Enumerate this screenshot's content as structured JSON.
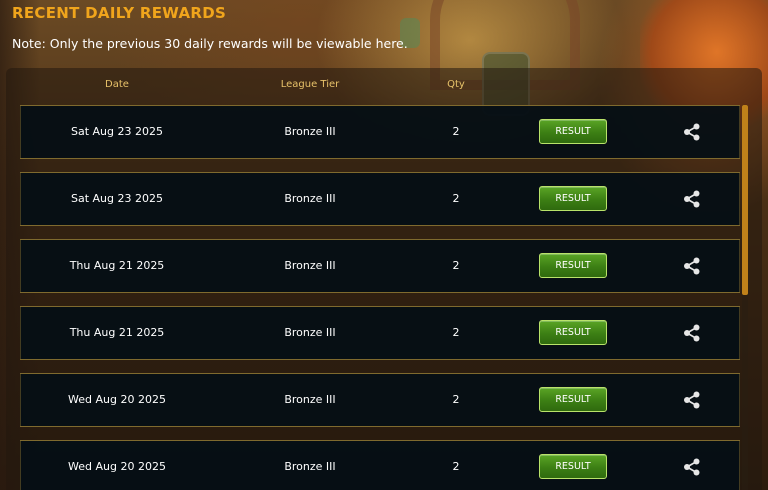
{
  "title": "RECENT DAILY REWARDS",
  "note": "Note: Only the previous 30 daily rewards will be viewable here.",
  "table": {
    "columns": {
      "date": "Date",
      "tier": "League Tier",
      "qty": "Qty"
    },
    "rows": [
      {
        "date": "Sat Aug 23 2025",
        "tier": "Bronze III",
        "qty": "2",
        "result_label": "RESULT"
      },
      {
        "date": "Sat Aug 23 2025",
        "tier": "Bronze III",
        "qty": "2",
        "result_label": "RESULT"
      },
      {
        "date": "Thu Aug 21 2025",
        "tier": "Bronze III",
        "qty": "2",
        "result_label": "RESULT"
      },
      {
        "date": "Thu Aug 21 2025",
        "tier": "Bronze III",
        "qty": "2",
        "result_label": "RESULT"
      },
      {
        "date": "Wed Aug 20 2025",
        "tier": "Bronze III",
        "qty": "2",
        "result_label": "RESULT"
      },
      {
        "date": "Wed Aug 20 2025",
        "tier": "Bronze III",
        "qty": "2",
        "result_label": "RESULT"
      }
    ]
  },
  "icons": {
    "share": "share-icon"
  },
  "colors": {
    "title": "#f0a51c",
    "header_text": "#e7c169",
    "row_background": "#040e14",
    "row_border": "#7f6a2e",
    "result_button": "#3c7f14",
    "scrollbar": "#c0811a"
  }
}
